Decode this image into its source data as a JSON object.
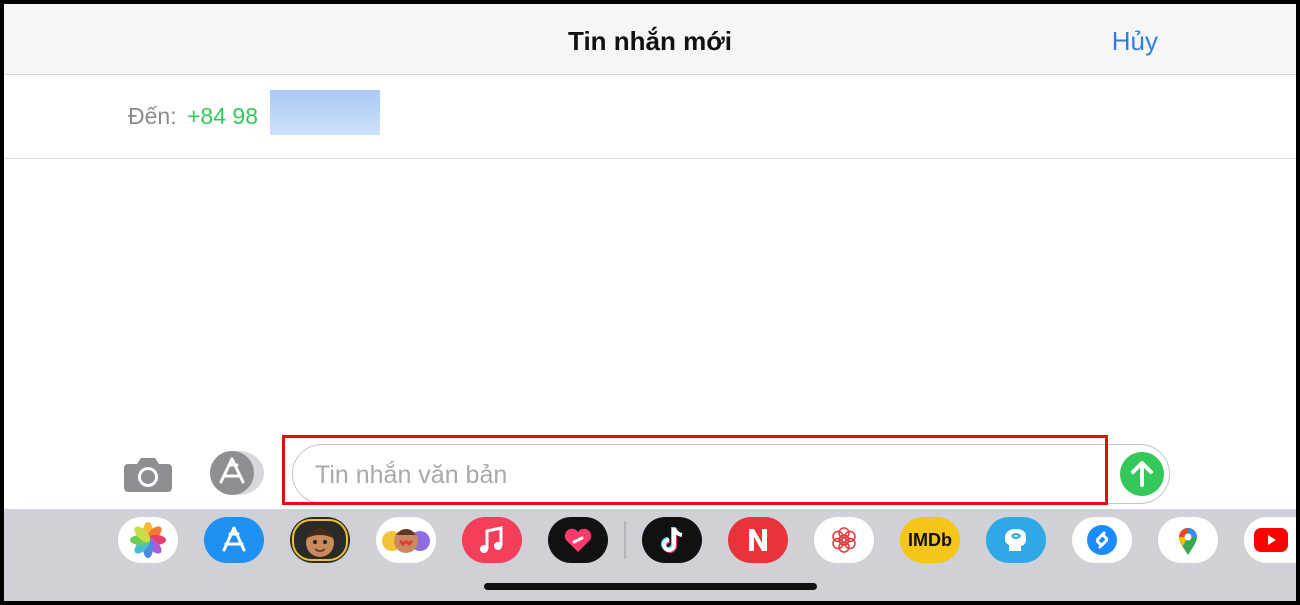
{
  "header": {
    "title": "Tin nhắn mới",
    "cancel_label": "Hủy"
  },
  "recipient": {
    "label": "Đến:",
    "number": "+84 98"
  },
  "composer": {
    "placeholder": "Tin nhắn văn bản",
    "value": ""
  },
  "drawer": {
    "apps": [
      {
        "name": "photos-icon"
      },
      {
        "name": "app-store-icon"
      },
      {
        "name": "memoji-icon"
      },
      {
        "name": "animoji-stickers-icon"
      },
      {
        "name": "music-icon"
      },
      {
        "name": "digital-touch-icon"
      },
      {
        "name": "tiktok-icon"
      },
      {
        "name": "news-icon"
      },
      {
        "name": "lotus-app-icon"
      },
      {
        "name": "imdb-icon",
        "label": "IMDb"
      },
      {
        "name": "brain-app-icon"
      },
      {
        "name": "shazam-icon"
      },
      {
        "name": "google-maps-icon"
      },
      {
        "name": "youtube-icon"
      }
    ]
  },
  "colors": {
    "accent_blue": "#2f7ee0",
    "green": "#34c759",
    "highlight_red": "#e10e0e"
  }
}
